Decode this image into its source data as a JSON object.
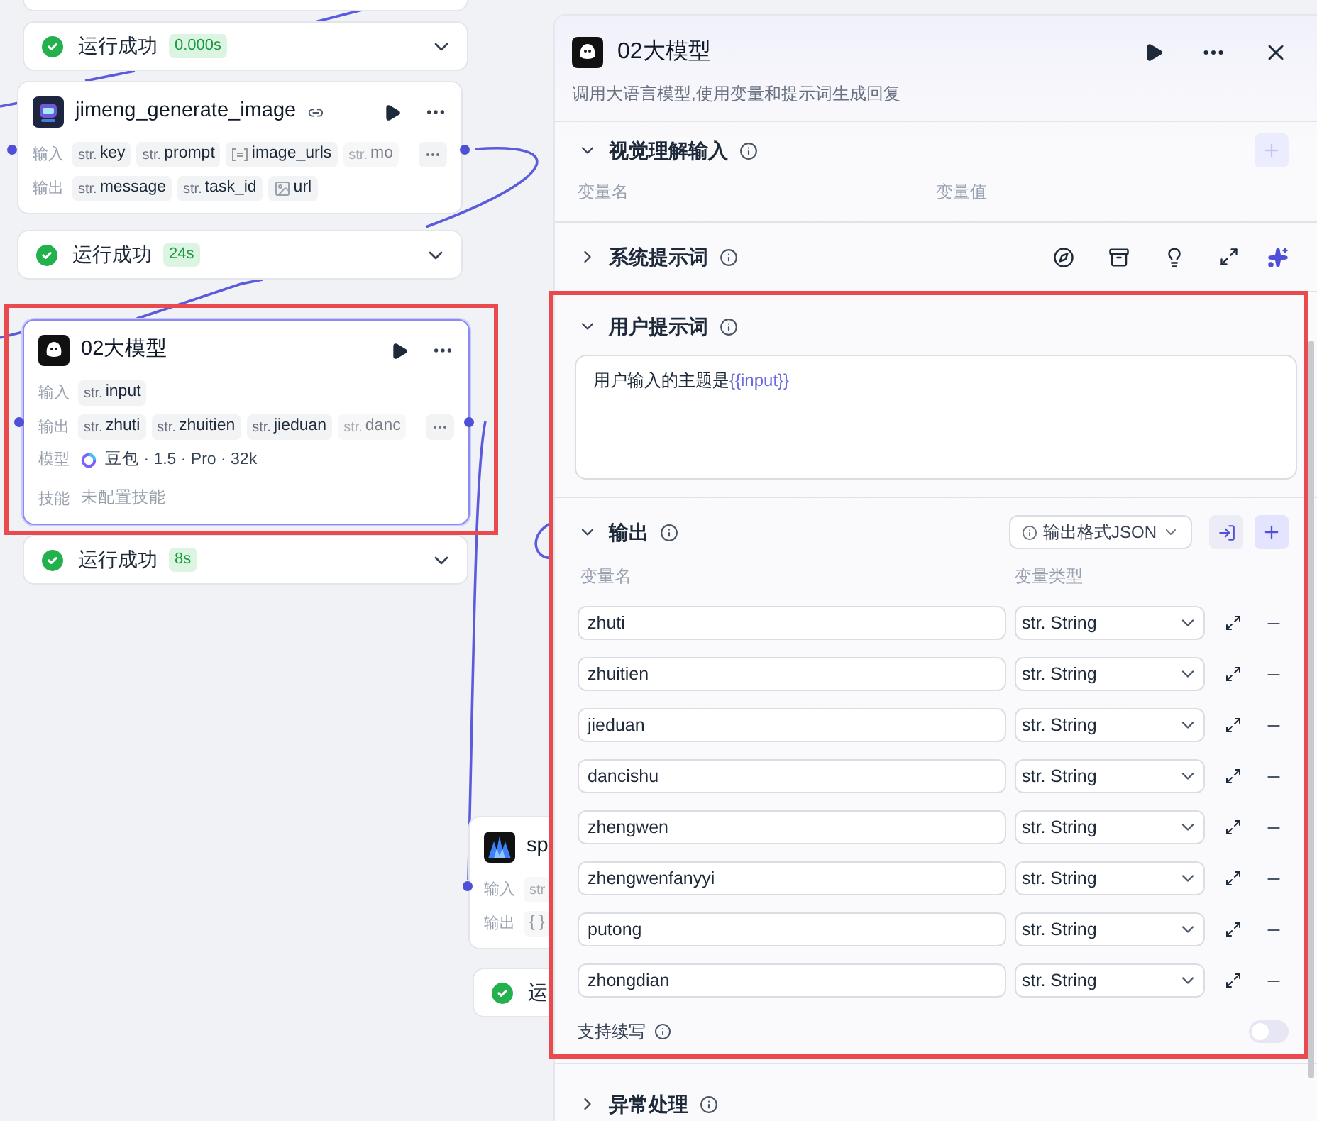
{
  "canvas": {
    "nodes": [
      {
        "kind": "stub"
      },
      {
        "kind": "status",
        "label": "运行成功",
        "time": "0.000s",
        "actions": [
          {
            "kind": "expand"
          }
        ]
      },
      {
        "kind": "node",
        "logo": {
          "kind": "picture"
        },
        "title": "jimeng_generate_image",
        "plugin_icon": true,
        "selected": false,
        "actions": [
          {
            "kind": "run"
          },
          {
            "kind": "more"
          }
        ],
        "rows": [
          {
            "label": "输入",
            "more": true,
            "tags": [
              {
                "kind": "str",
                "prefix": "str.",
                "name": "key",
                "faded": false
              },
              {
                "kind": "str",
                "prefix": "str.",
                "name": "prompt",
                "faded": false
              },
              {
                "kind": "array",
                "name": "image_urls",
                "faded": false
              },
              {
                "kind": "str",
                "prefix": "str.",
                "name": "mo",
                "faded": true
              }
            ]
          },
          {
            "label": "输出",
            "more": false,
            "tags": [
              {
                "kind": "str",
                "prefix": "str.",
                "name": "message",
                "faded": false
              },
              {
                "kind": "str",
                "prefix": "str.",
                "name": "task_id",
                "faded": false
              },
              {
                "kind": "image",
                "name": "url",
                "faded": false
              }
            ]
          }
        ]
      },
      {
        "kind": "status",
        "label": "运行成功",
        "time": "24s",
        "actions": [
          {
            "kind": "expand"
          }
        ]
      },
      {
        "kind": "node",
        "logo": {
          "kind": "ghost"
        },
        "title": "02大模型",
        "plugin_icon": false,
        "selected": true,
        "actions": [
          {
            "kind": "run"
          },
          {
            "kind": "more"
          }
        ],
        "rows": [
          {
            "label": "输入",
            "more": false,
            "tags": [
              {
                "kind": "str",
                "prefix": "str.",
                "name": "input",
                "faded": false
              }
            ]
          },
          {
            "label": "输出",
            "more": true,
            "tags": [
              {
                "kind": "str",
                "prefix": "str.",
                "name": "zhuti",
                "faded": false
              },
              {
                "kind": "str",
                "prefix": "str.",
                "name": "zhuitien",
                "faded": false
              },
              {
                "kind": "str",
                "prefix": "str.",
                "name": "jieduan",
                "faded": false
              },
              {
                "kind": "str",
                "prefix": "str.",
                "name": "danc",
                "faded": true
              }
            ]
          }
        ],
        "model": {
          "label": "模型",
          "name": "豆包 · 1.5 · Pro · 32k"
        },
        "skill": {
          "label": "技能",
          "value": "未配置技能"
        }
      },
      {
        "kind": "status",
        "label": "运行成功",
        "time": "8s",
        "actions": [
          {
            "kind": "expand"
          }
        ]
      },
      {
        "kind": "node",
        "logo": {
          "kind": "flame"
        },
        "title": "sp",
        "plugin_icon": false,
        "selected": false,
        "rows": [
          {
            "label": "输入",
            "more": false,
            "tags": [
              {
                "kind": "str",
                "prefix": "str",
                "faded": true
              }
            ]
          },
          {
            "label": "输出",
            "more": false,
            "tags": [
              {
                "kind": "object",
                "prefix": "{ }",
                "faded": true
              }
            ]
          }
        ]
      },
      {
        "kind": "status",
        "label": "运"
      }
    ]
  },
  "panel": {
    "title": "02大模型",
    "description": "调用大语言模型,使用变量和提示词生成回复",
    "vision": {
      "title": "视觉理解输入",
      "expanded": true,
      "add_disabled": true,
      "columns": [
        "变量名",
        "变量值"
      ]
    },
    "system_prompt": {
      "title": "系统提示词",
      "expanded": false
    },
    "user_prompt": {
      "title": "用户提示词",
      "expanded": true,
      "text": "用户输入的主题是",
      "variable": "{{input}}"
    },
    "output": {
      "title": "输出",
      "expanded": true,
      "format": "输出格式JSON",
      "columns": [
        "变量名",
        "变量类型"
      ],
      "rows": [
        {
          "name": "zhuti",
          "type": "str. String"
        },
        {
          "name": "zhuitien",
          "type": "str. String"
        },
        {
          "name": "jieduan",
          "type": "str. String"
        },
        {
          "name": "dancishu",
          "type": "str. String"
        },
        {
          "name": "zhengwen",
          "type": "str. String"
        },
        {
          "name": "zhengwenfanyyi",
          "type": "str. String"
        },
        {
          "name": "putong",
          "type": "str. String"
        },
        {
          "name": "zhongdian",
          "type": "str. String"
        }
      ],
      "continuation": {
        "label": "支持续写",
        "on": false
      }
    },
    "error_handling": {
      "title": "异常处理",
      "expanded": false
    }
  }
}
